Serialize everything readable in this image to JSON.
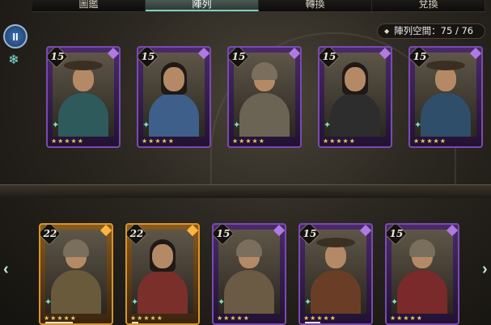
{
  "tabs": [
    {
      "label": "圖鑑",
      "active": false
    },
    {
      "label": "陣列",
      "active": true
    },
    {
      "label": "轉換",
      "active": false
    },
    {
      "label": "兌換",
      "active": false
    }
  ],
  "pause_button": {
    "icon": "pause-icon",
    "label": "II"
  },
  "frost_icon": "snowflake-icon",
  "capacity": {
    "label": "陣列空間：",
    "value": "75 / 76"
  },
  "formation": [
    {
      "level": "15",
      "frame": "purple",
      "figure": "cowboy-hat",
      "coat": "#2f5a5c"
    },
    {
      "level": "15",
      "frame": "purple",
      "figure": "woman-headdress",
      "coat": "#3d5f8a"
    },
    {
      "level": "15",
      "frame": "purple",
      "figure": "armored-helmet",
      "coat": "#6b6455"
    },
    {
      "level": "15",
      "frame": "purple",
      "figure": "long-hair",
      "coat": "#2d2d2d"
    },
    {
      "level": "15",
      "frame": "purple",
      "figure": "cowboy-hat",
      "coat": "#2f4e6a"
    }
  ],
  "roster": [
    {
      "level": "22",
      "frame": "gold",
      "figure": "armored-helmet",
      "coat": "#6a5a3c",
      "progress": 0.45
    },
    {
      "level": "22",
      "frame": "gold",
      "figure": "long-hair",
      "coat": "#7a2f2a",
      "progress": 0.1
    },
    {
      "level": "15",
      "frame": "purple",
      "figure": "armored-helmet",
      "coat": "#6b5a44",
      "progress": 0.0
    },
    {
      "level": "15",
      "frame": "purple",
      "figure": "cowboy-hat",
      "coat": "#6a3e26",
      "progress": 0.25
    },
    {
      "level": "15",
      "frame": "purple",
      "figure": "armored-helmet",
      "coat": "#7a2a2a",
      "progress": 0.0
    }
  ],
  "stars": "★★★★★",
  "nav": {
    "left": "‹",
    "right": "›"
  }
}
